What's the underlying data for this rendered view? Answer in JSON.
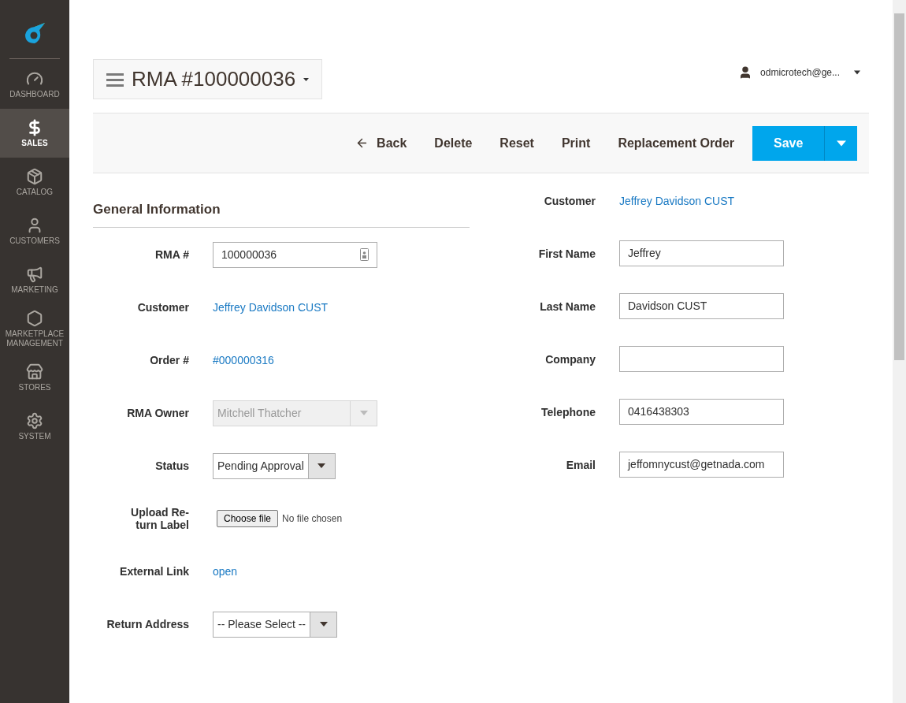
{
  "sidebar": {
    "items": [
      {
        "label": "DASHBOARD",
        "selected": false
      },
      {
        "label": "SALES",
        "selected": true
      },
      {
        "label": "CATALOG",
        "selected": false
      },
      {
        "label": "CUSTOMERS",
        "selected": false
      },
      {
        "label": "MARKETING",
        "selected": false
      },
      {
        "label": "MARKETPLACE MANAGEMENT",
        "selected": false
      },
      {
        "label": "STORES",
        "selected": false
      },
      {
        "label": "SYSTEM",
        "selected": false
      }
    ]
  },
  "page_title": "RMA #100000036",
  "user": "odmicrotech@ge...",
  "toolbar": {
    "actions": [
      "Back",
      "Delete",
      "Reset",
      "Print",
      "Replacement Order"
    ],
    "save": "Save"
  },
  "general": {
    "title": "General Information",
    "fields": [
      {
        "kind": "input",
        "label": "RMA #",
        "value": "100000036"
      },
      {
        "kind": "link",
        "label": "Customer",
        "value": "Jeffrey Davidson CUST"
      },
      {
        "kind": "link",
        "label": "Order #",
        "value": "#000000316"
      },
      {
        "kind": "select",
        "label": "RMA Owner",
        "value": "Mitchell Thatcher",
        "disabled": true
      },
      {
        "kind": "select",
        "label": "Status",
        "value": "Pending Approval",
        "disabled": false
      },
      {
        "kind": "file",
        "label": "Upload Re-turn Label",
        "value": "Choose file",
        "note": "No file chosen"
      },
      {
        "kind": "link",
        "label": "External Link",
        "value": "open"
      },
      {
        "kind": "select",
        "label": "Return Address",
        "value": "-- Please Select --",
        "disabled": false
      }
    ]
  },
  "customer": {
    "fields": [
      {
        "kind": "link",
        "label": "Customer",
        "value": "Jeffrey Davidson CUST"
      },
      {
        "kind": "input",
        "label": "First Name",
        "value": "Jeffrey"
      },
      {
        "kind": "input",
        "label": "Last Name",
        "value": "Davidson CUST"
      },
      {
        "kind": "input",
        "label": "Company"
      },
      {
        "kind": "input",
        "label": "Telephone",
        "value": "0416438303"
      },
      {
        "kind": "input",
        "label": "Email",
        "value": "jeffomnycust@getnada.com"
      }
    ]
  }
}
